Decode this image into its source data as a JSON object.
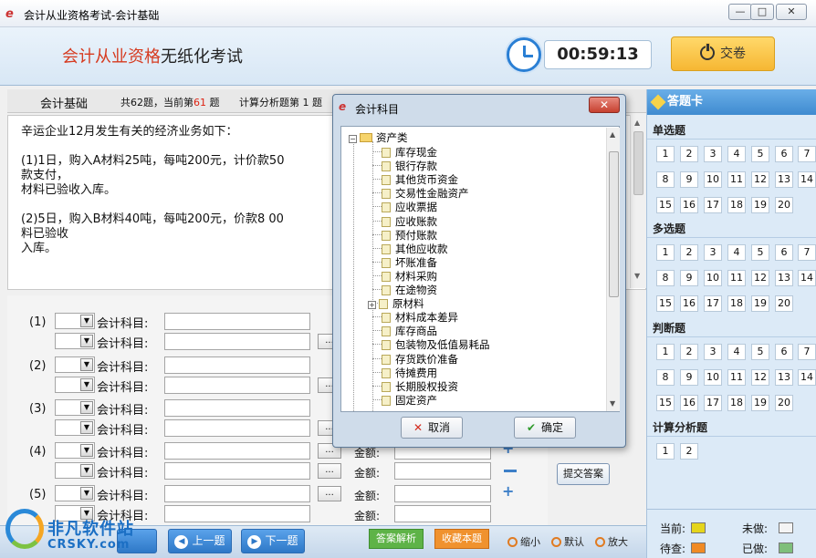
{
  "window": {
    "title": "会计从业资格考试-会计基础"
  },
  "header": {
    "brand_red": "会计从业资格",
    "brand_rest": "无纸化考试",
    "timer": "00:59:13",
    "submit_label": "交卷"
  },
  "infobar": {
    "subject": "会计基础",
    "count_prefix": "共62题，当前第",
    "current": "61",
    "count_suffix": "题",
    "type": "计算分析题第 1 题"
  },
  "question": {
    "lines": [
      "辛运企业12月发生有关的经济业务如下：",
      "(1)1日，购入A材料25吨，每吨200元，计价款50",
      "款支付，",
      "材料已验收入库。",
      "(2)5日，购入B材料40吨，每吨200元，价款8 00",
      "料已验收",
      "入库。"
    ]
  },
  "answers": {
    "row_labels": [
      "(1)",
      "(2)",
      "(3)",
      "(4)",
      "(5)"
    ],
    "account_label": "会计科目:",
    "amount_label": "金额:",
    "dots_label": "...",
    "submit_label": "提交答案"
  },
  "bottom": {
    "prev_label": "上一题",
    "next_label": "下一题",
    "analysis_label": "答案解析",
    "favorite_label": "收藏本题",
    "zoom_out": "缩小",
    "zoom_default": "默认",
    "zoom_in": "放大"
  },
  "watermark": {
    "line1": "非凡软件站",
    "line2": "CRSKY.com"
  },
  "card": {
    "title": "答题卡",
    "sections": [
      {
        "name": "单选题",
        "numbers": [
          "1",
          "2",
          "3",
          "4",
          "5",
          "6",
          "7",
          "8",
          "9",
          "10",
          "11",
          "12",
          "13",
          "14",
          "15",
          "16",
          "17",
          "18",
          "19",
          "20"
        ]
      },
      {
        "name": "多选题",
        "numbers": [
          "1",
          "2",
          "3",
          "4",
          "5",
          "6",
          "7",
          "8",
          "9",
          "10",
          "11",
          "12",
          "13",
          "14",
          "15",
          "16",
          "17",
          "18",
          "19",
          "20"
        ]
      },
      {
        "name": "判断题",
        "numbers": [
          "1",
          "2",
          "3",
          "4",
          "5",
          "6",
          "7",
          "8",
          "9",
          "10",
          "11",
          "12",
          "13",
          "14",
          "15",
          "16",
          "17",
          "18",
          "19",
          "20"
        ]
      },
      {
        "name": "计算分析题",
        "numbers": [
          "1",
          "2"
        ]
      }
    ],
    "legend": {
      "current": "当前:",
      "undone": "未做:",
      "pending": "待查:",
      "done": "已做:"
    },
    "colors": {
      "current": "#e5d51c",
      "undone": "#f4f4f4",
      "pending": "#f08a24",
      "done": "#7fbf7b"
    }
  },
  "dialog": {
    "title": "会计科目",
    "root": "资产类",
    "items": [
      "库存现金",
      "银行存款",
      "其他货币资金",
      "交易性金融资产",
      "应收票据",
      "应收账款",
      "预付账款",
      "其他应收款",
      "坏账准备",
      "材料采购",
      "在途物资",
      "原材料",
      "材料成本差异",
      "库存商品",
      "包装物及低值易耗品",
      "存货跌价准备",
      "待摊费用",
      "长期股权投资",
      "固定资产"
    ],
    "cancel_label": "取消",
    "ok_label": "确定"
  }
}
